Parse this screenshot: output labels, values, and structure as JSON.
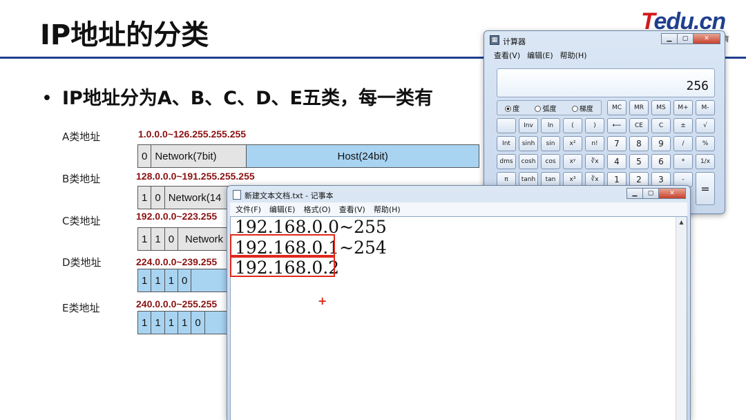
{
  "slide": {
    "title": "IP地址的分类",
    "bullet": "IP地址分为A、B、C、D、E五类，每一类有",
    "logo_t": "T",
    "logo_rest": "edu.cn",
    "logo_sub": "育"
  },
  "classes": [
    {
      "label": "A类地址",
      "range": "1.0.0.0~126.255.255.255",
      "bits": [
        "0"
      ],
      "network": "Network(7bit)",
      "host": "Host(24bit)"
    },
    {
      "label": "B类地址",
      "range": "128.0.0.0~191.255.255.255",
      "bits": [
        "1",
        "0"
      ],
      "network": "Network(14",
      "host": ""
    },
    {
      "label": "C类地址",
      "range": "192.0.0.0~223.255",
      "bits": [
        "1",
        "1",
        "0"
      ],
      "network": "Network",
      "host": ""
    },
    {
      "label": "D类地址",
      "range": "224.0.0.0~239.255",
      "bits": [
        "1",
        "1",
        "1",
        "0"
      ],
      "network": "",
      "host": ""
    },
    {
      "label": "E类地址",
      "range": "240.0.0.0~255.255",
      "bits": [
        "1",
        "1",
        "1",
        "1",
        "0"
      ],
      "network": "",
      "host": ""
    }
  ],
  "calculator": {
    "title": "计算器",
    "menu": [
      "查看(V)",
      "编辑(E)",
      "帮助(H)"
    ],
    "display": "256",
    "angle_modes": [
      "度",
      "弧度",
      "梯度"
    ],
    "selected_mode": "度",
    "buttons": [
      "MC",
      "MR",
      "MS",
      "M+",
      "M-",
      "",
      "Inv",
      "ln",
      "(",
      ")",
      "⟵",
      "CE",
      "C",
      "±",
      "√",
      "Int",
      "sinh",
      "sin",
      "x²",
      "n!",
      "7",
      "8",
      "9",
      "/",
      "%",
      "dms",
      "cosh",
      "cos",
      "xʸ",
      "∛x",
      "4",
      "5",
      "6",
      "*",
      "1/x",
      "π",
      "tanh",
      "tan",
      "x³",
      "∛x",
      "1",
      "2",
      "3",
      "-",
      "="
    ]
  },
  "notepad": {
    "title": "新建文本文档.txt - 记事本",
    "menu": [
      "文件(F)",
      "编辑(E)",
      "格式(O)",
      "查看(V)",
      "帮助(H)"
    ],
    "lines": [
      "192.168.0.0~255",
      "192.168.0.1~254",
      "192.168.0.2"
    ]
  },
  "annotation": {
    "cursor": "+",
    "box_color": "#e0271b"
  }
}
